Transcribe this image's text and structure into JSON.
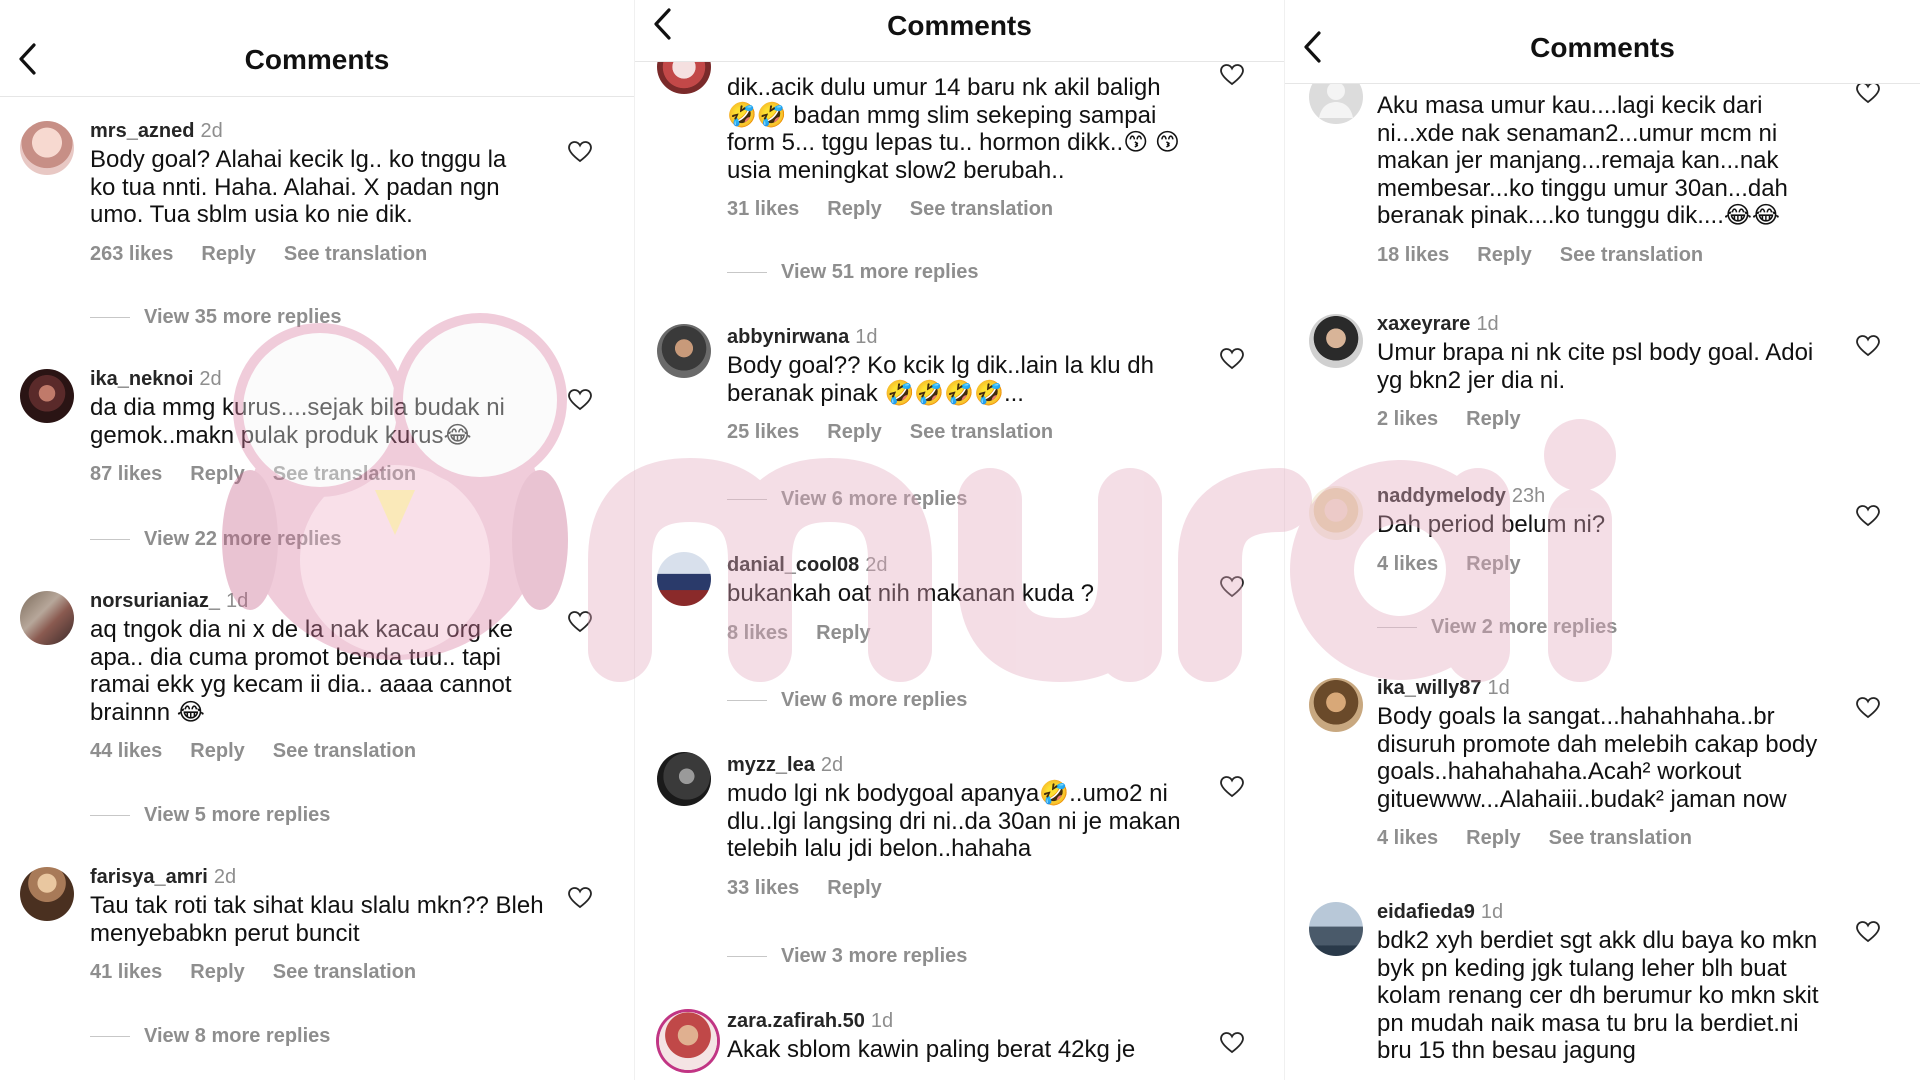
{
  "panels": [
    {
      "title": "Comments",
      "comments": [
        {
          "user": "mrs_azned",
          "time": "2d",
          "text": "Body goal? Alahai kecik lg.. ko tnggu la ko tua nnti. Haha. Alahai. X padan ngn umo. Tua sblm usia ko nie dik.",
          "likes": "263 likes",
          "reply": "Reply",
          "translation": "See translation",
          "more_replies": "View 35 more replies"
        },
        {
          "user": "ika_neknoi",
          "time": "2d",
          "text": "da dia mmg kurus....sejak  bila  budak ni gemok..makn pulak produk kurus😂",
          "likes": "87 likes",
          "reply": "Reply",
          "translation": "See translation",
          "more_replies": "View 22 more replies"
        },
        {
          "user": "norsurianiaz_",
          "time": "1d",
          "text": "aq tngok dia ni x de la nak kacau org ke apa.. dia cuma promot benda tuu.. tapi ramai ekk yg kecam ii dia.. aaaa cannot brainnn 😂",
          "likes": "44 likes",
          "reply": "Reply",
          "translation": "See translation",
          "more_replies": "View 5 more replies"
        },
        {
          "user": "farisya_amri",
          "time": "2d",
          "text": "Tau tak roti tak sihat klau slalu mkn?? Bleh menyebabkn perut buncit",
          "likes": "41 likes",
          "reply": "Reply",
          "translation": "See translation",
          "more_replies": "View 8 more replies"
        }
      ]
    },
    {
      "title": "Comments",
      "comments": [
        {
          "user": "",
          "time": "",
          "text": "dik..acik dulu umur 14 baru nk akil baligh 🤣🤣 badan mmg slim sekeping sampai form 5... tggu lepas tu.. hormon dikk..😙 😙 usia meningkat slow2 berubah..",
          "likes": "31 likes",
          "reply": "Reply",
          "translation": "See translation",
          "more_replies": "View 51 more replies"
        },
        {
          "user": "abbynirwana",
          "time": "1d",
          "text": "Body goal?? Ko kcik lg dik..lain la klu dh beranak pinak 🤣🤣🤣🤣...",
          "likes": "25 likes",
          "reply": "Reply",
          "translation": "See translation",
          "more_replies": "View 6 more replies"
        },
        {
          "user": "danial_cool08",
          "time": "2d",
          "text": "bukankah oat nih makanan kuda ?",
          "likes": "8 likes",
          "reply": "Reply",
          "translation": "",
          "more_replies": "View 6 more replies"
        },
        {
          "user": "myzz_lea",
          "time": "2d",
          "text": "mudo lgi nk bodygoal apanya🤣..umo2 ni dlu..lgi langsing dri ni..da 30an ni je makan telebih lalu jdi  belon..hahaha",
          "likes": "33 likes",
          "reply": "Reply",
          "translation": "",
          "more_replies": "View 3 more replies"
        },
        {
          "user": "zara.zafirah.50",
          "time": "1d",
          "text": "Akak sblom kawin paling berat 42kg je",
          "likes": "",
          "reply": "",
          "translation": "",
          "more_replies": ""
        }
      ]
    },
    {
      "title": "Comments",
      "comments": [
        {
          "user": "",
          "time": "",
          "text": "Aku masa umur kau....lagi kecik dari ni...xde nak senaman2...umur mcm ni makan jer manjang...remaja kan...nak membesar...ko tinggu umur 30an...dah beranak pinak....ko tunggu dik....😂😂",
          "likes": "18 likes",
          "reply": "Reply",
          "translation": "See translation",
          "more_replies": ""
        },
        {
          "user": "xaxeyrare",
          "time": "1d",
          "text": "Umur brapa ni nk cite psl body goal. Adoi yg bkn2 jer dia ni.",
          "likes": "2 likes",
          "reply": "Reply",
          "translation": "",
          "more_replies": ""
        },
        {
          "user": "naddymelody",
          "time": "23h",
          "text": "Dah period belum ni?",
          "likes": "4 likes",
          "reply": "Reply",
          "translation": "",
          "more_replies": "View 2 more replies"
        },
        {
          "user": "ika_willy87",
          "time": "1d",
          "text": "Body goals la sangat...hahahhaha..br disuruh promote dah melebih cakap body goals..hahahahaha.Acah² workout gituewww...Alahaiii..budak² jaman now",
          "likes": "4 likes",
          "reply": "Reply",
          "translation": "See translation",
          "more_replies": ""
        },
        {
          "user": "eidafieda9",
          "time": "1d",
          "text": "bdk2 xyh berdiet sgt akk dlu baya ko mkn byk pn keding jgk tulang leher blh buat kolam renang cer dh berumur ko mkn skit pn mudah naik masa tu bru la berdiet.ni bru 15 thn besau jagung",
          "likes": "",
          "reply": "",
          "translation": "",
          "more_replies": ""
        }
      ]
    }
  ],
  "watermark": {
    "text": "murai"
  },
  "colors": {
    "meta_gray": "#8e8e8e",
    "watermark": "#e8b8c8",
    "story_ring": "#c13584"
  }
}
